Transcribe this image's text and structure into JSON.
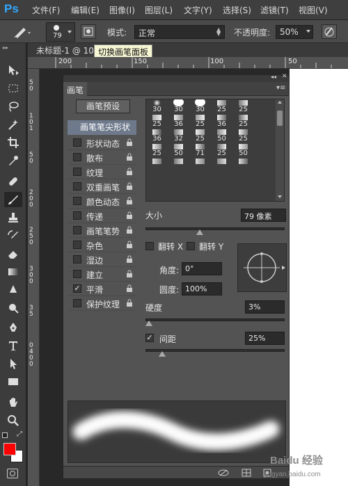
{
  "app": {
    "logo": "Ps"
  },
  "menu": [
    "文件(F)",
    "编辑(E)",
    "图像(I)",
    "图层(L)",
    "文字(Y)",
    "选择(S)",
    "滤镜(T)",
    "视图(V)"
  ],
  "options_bar": {
    "brush_size": "79",
    "mode_label": "模式:",
    "mode_value": "正常",
    "opacity_label": "不透明度:",
    "opacity_value": "50%"
  },
  "document_tab": "未标题-1 @ 100",
  "tooltip": "切换画笔面板",
  "ruler_numbers": [
    "200",
    "150",
    "100",
    "50"
  ],
  "ruler_vertical": [
    "5",
    "0",
    "1",
    "0",
    "1",
    "5",
    "0",
    "2",
    "0",
    "0",
    "2",
    "5",
    "0",
    "3",
    "0",
    "0",
    "3",
    "5",
    "0",
    "4",
    "0",
    "0"
  ],
  "panel": {
    "tab_label": "画笔",
    "preset_button": "画笔预设",
    "tip_shape": "画笔笔尖形状",
    "options": [
      {
        "label": "形状动态",
        "checked": false
      },
      {
        "label": "散布",
        "checked": false
      },
      {
        "label": "纹理",
        "checked": false
      },
      {
        "label": "双重画笔",
        "checked": false
      },
      {
        "label": "颜色动态",
        "checked": false
      },
      {
        "label": "传递",
        "checked": false
      },
      {
        "label": "画笔笔势",
        "checked": false
      },
      {
        "label": "杂色",
        "checked": false
      },
      {
        "label": "湿边",
        "checked": false
      },
      {
        "label": "建立",
        "checked": false
      },
      {
        "label": "平滑",
        "checked": true
      },
      {
        "label": "保护纹理",
        "checked": false
      }
    ],
    "brush_sizes": [
      "30",
      "30",
      "30",
      "25",
      "25",
      "25",
      "36",
      "25",
      "36",
      "25",
      "36",
      "32",
      "25",
      "50",
      "25",
      "25",
      "50",
      "71",
      "25",
      "50"
    ],
    "size_label": "大小",
    "size_value": "79 像素",
    "flip_x_label": "翻转 X",
    "flip_y_label": "翻转 Y",
    "angle_label": "角度:",
    "angle_value": "0°",
    "roundness_label": "圆度:",
    "roundness_value": "100%",
    "hardness_label": "硬度",
    "hardness_value": "3%",
    "spacing_label": "间距",
    "spacing_value": "25%",
    "spacing_checked": true
  },
  "watermark": {
    "site": "Baidu 经验",
    "url": "jingyan.baidu.com"
  },
  "colors": {
    "foreground": "#ff0000",
    "background": "#ffffff",
    "accent": "#31a8ff",
    "selected_row": "#6e7a8c"
  },
  "tools": [
    "move-icon",
    "marquee-icon",
    "lasso-icon",
    "magic-wand-icon",
    "crop-icon",
    "eyedropper-icon",
    "healing-brush-icon",
    "brush-icon",
    "clone-stamp-icon",
    "history-brush-icon",
    "eraser-icon",
    "gradient-icon",
    "blur-icon",
    "dodge-icon",
    "pen-icon",
    "type-icon",
    "path-selection-icon",
    "rectangle-icon",
    "hand-icon",
    "zoom-icon"
  ]
}
